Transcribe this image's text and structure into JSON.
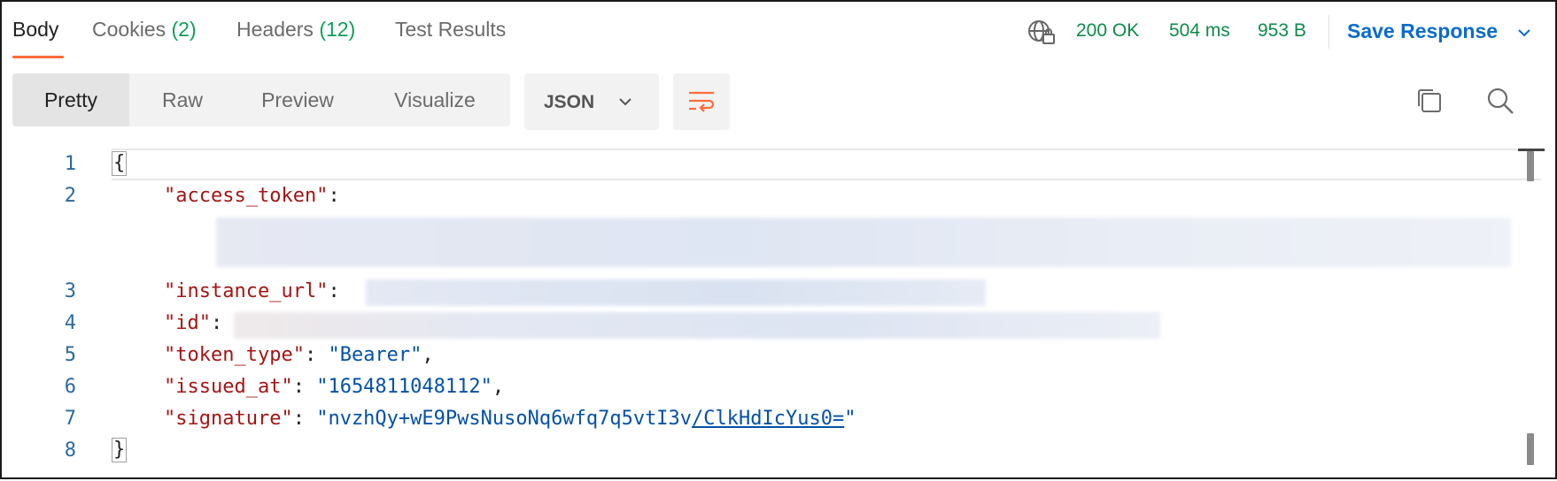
{
  "tabs": [
    {
      "label": "Body",
      "count": ""
    },
    {
      "label": "Cookies",
      "count": "(2)"
    },
    {
      "label": "Headers",
      "count": "(12)"
    },
    {
      "label": "Test Results",
      "count": ""
    }
  ],
  "status": {
    "code": "200 OK",
    "time": "504 ms",
    "size": "953 B",
    "save_label": "Save Response",
    "color": "#0f8a4a"
  },
  "view_modes": [
    "Pretty",
    "Raw",
    "Preview",
    "Visualize"
  ],
  "format": {
    "selected": "JSON"
  },
  "icons": {
    "globe": "globe-lock-icon",
    "wrap": "word-wrap-icon",
    "copy": "copy-icon",
    "search": "search-icon"
  },
  "code": {
    "line_numbers": [
      "1",
      "2",
      "3",
      "4",
      "5",
      "6",
      "7",
      "8"
    ],
    "open_brace": "{",
    "close_brace": "}",
    "access_token_key": "\"access_token\"",
    "instance_url_key": "\"instance_url\"",
    "id_key": "\"id\"",
    "token_type_key": "\"token_type\"",
    "token_type_value": "\"Bearer\"",
    "issued_at_key": "\"issued_at\"",
    "issued_at_value": "\"1654811048112\"",
    "signature_key": "\"signature\"",
    "signature_value_a": "\"nvzhQy+wE9PwsNusoNq6wfq7q5vtI3v",
    "signature_value_b": "/ClkHdIcYus0=",
    "signature_value_c": "\""
  },
  "accent": "#ff6c37",
  "link_color": "#0b6bcb"
}
